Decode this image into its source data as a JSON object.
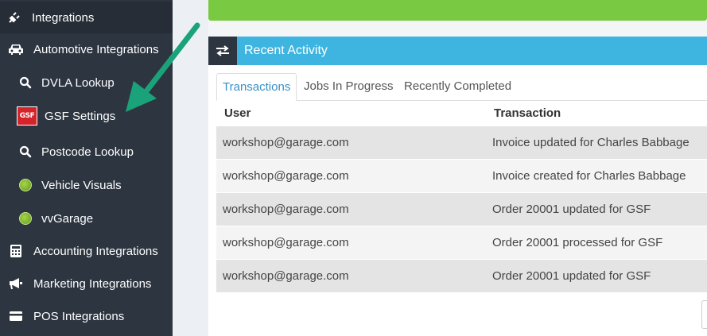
{
  "sidebar": {
    "items": [
      {
        "label": "Integrations",
        "icon": "plug-icon"
      },
      {
        "label": "Automotive Integrations",
        "icon": "car-icon"
      },
      {
        "label": "DVLA Lookup",
        "icon": "search-icon"
      },
      {
        "label": "GSF Settings",
        "icon": "gsf-logo-icon"
      },
      {
        "label": "Postcode Lookup",
        "icon": "search-icon"
      },
      {
        "label": "Vehicle Visuals",
        "icon": "vehicle-visuals-icon"
      },
      {
        "label": "vvGarage",
        "icon": "vvgarage-icon"
      },
      {
        "label": "Accounting Integrations",
        "icon": "calculator-icon"
      },
      {
        "label": "Marketing Integrations",
        "icon": "megaphone-icon"
      },
      {
        "label": "POS Integrations",
        "icon": "credit-card-icon"
      }
    ],
    "gsf_logo_text": "GSF"
  },
  "panel": {
    "title": "Recent Activity",
    "icon": "exchange-icon"
  },
  "tabs": [
    {
      "label": "Transactions",
      "active": true
    },
    {
      "label": "Jobs In Progress",
      "active": false
    },
    {
      "label": "Recently Completed",
      "active": false
    }
  ],
  "table": {
    "headers": [
      "User",
      "Transaction"
    ],
    "rows": [
      {
        "user": "workshop@garage.com",
        "transaction": "Invoice updated for Charles Babbage"
      },
      {
        "user": "workshop@garage.com",
        "transaction": "Invoice created for Charles Babbage"
      },
      {
        "user": "workshop@garage.com",
        "transaction": "Order 20001 updated for GSF"
      },
      {
        "user": "workshop@garage.com",
        "transaction": "Order 20001 processed for GSF"
      },
      {
        "user": "workshop@garage.com",
        "transaction": "Order 20001 updated for GSF"
      }
    ]
  },
  "colors": {
    "sidebar_bg": "#2d3540",
    "header_blue": "#3db5e0",
    "success_green": "#7ac943",
    "annotation_arrow": "#1aa37a",
    "active_tab_text": "#3a8fc2"
  }
}
